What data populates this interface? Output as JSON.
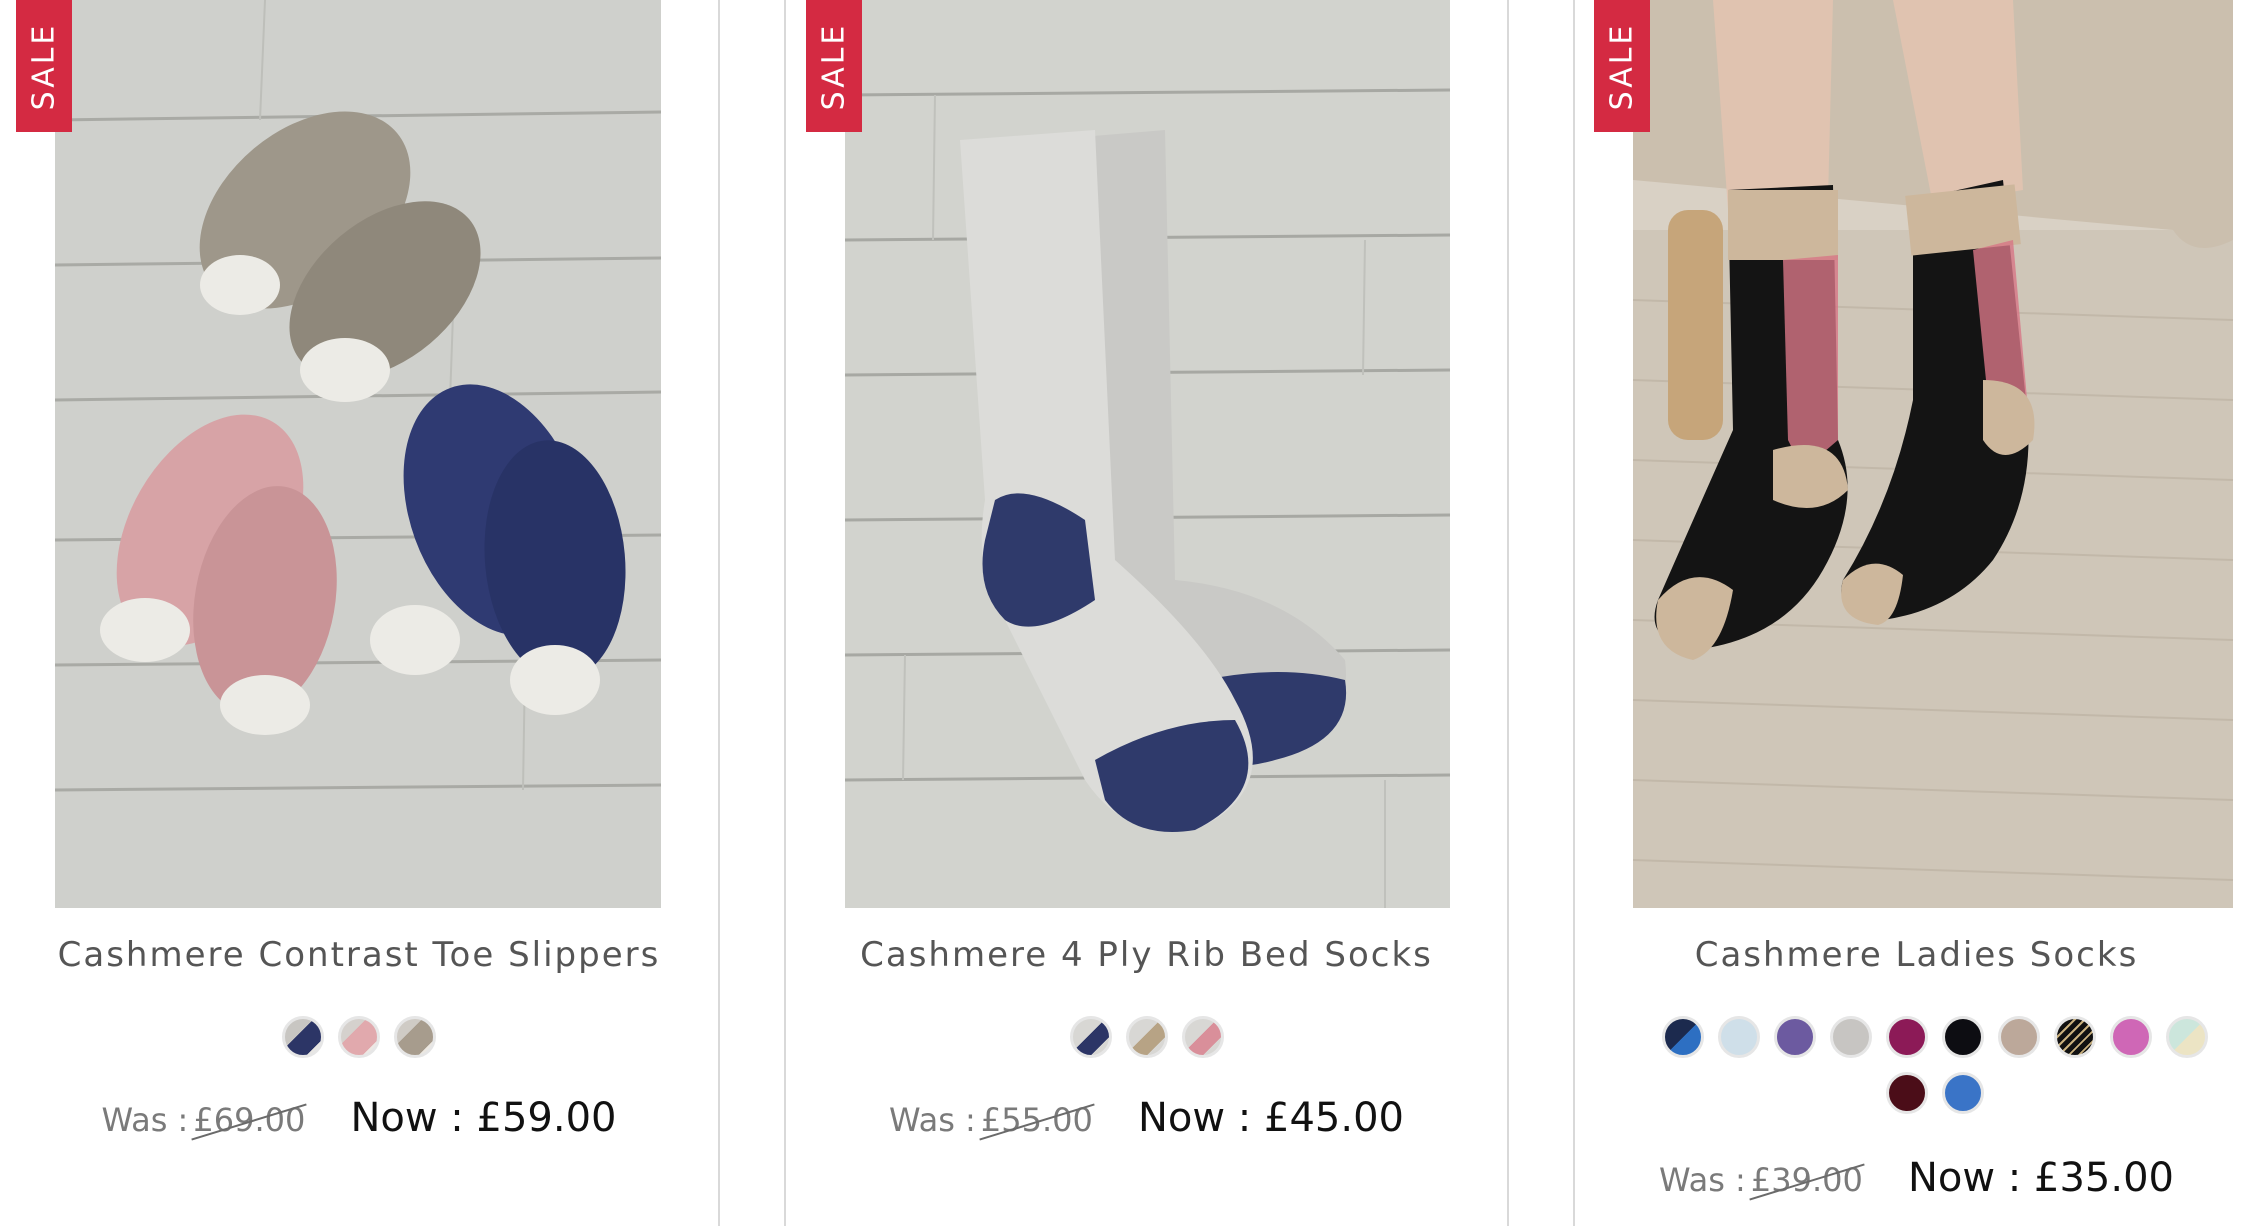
{
  "products": [
    {
      "badge": "SALE",
      "title": "Cashmere Contrast Toe Slippers",
      "swatches": [
        "navy-white",
        "pink-white",
        "taupe-white"
      ],
      "was_label": "Was :",
      "was_price": "£69.00",
      "now_label": "Now :",
      "now_price": "£59.00"
    },
    {
      "badge": "SALE",
      "title": "Cashmere 4 Ply Rib Bed Socks",
      "swatches": [
        "grey-navy",
        "grey-camel",
        "grey-pink"
      ],
      "was_label": "Was :",
      "was_price": "£55.00",
      "now_label": "Now :",
      "now_price": "£45.00"
    },
    {
      "badge": "SALE",
      "title": "Cashmere Ladies Socks",
      "swatches": [
        "navy-blue",
        "pale-blue",
        "lavender",
        "light-grey",
        "plum",
        "black",
        "taupe",
        "black-stripe",
        "pink",
        "mint-cream",
        "burgundy",
        "royal-blue"
      ],
      "was_label": "Was :",
      "was_price": "£39.00",
      "now_label": "Now :",
      "now_price": "£35.00"
    }
  ],
  "colors": {
    "sale_badge": "#d42a42",
    "title": "#555555",
    "now_price": "#111111",
    "was_price": "#7a7a7a"
  }
}
